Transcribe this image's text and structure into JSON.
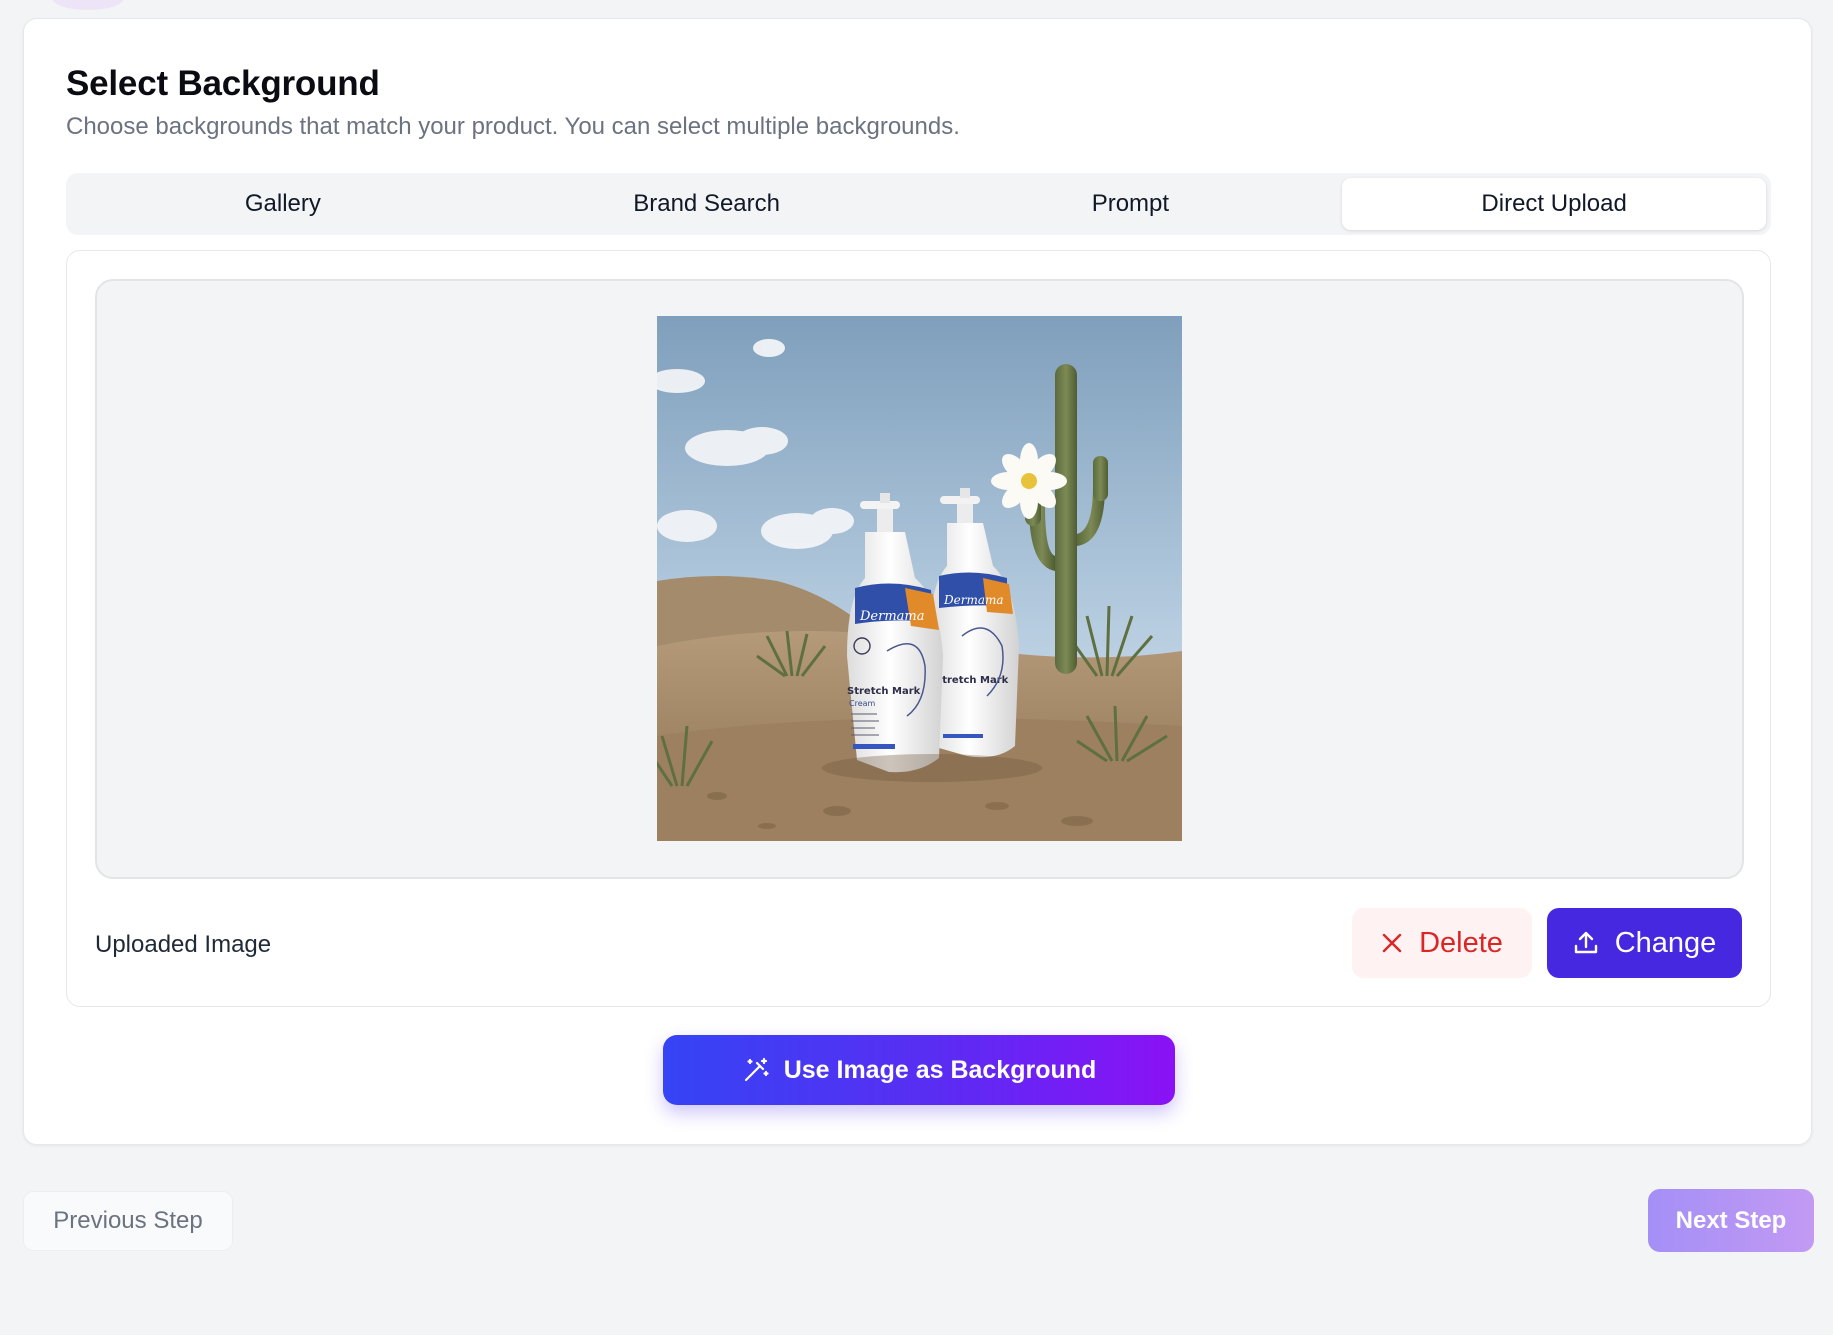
{
  "header": {
    "title": "Select Background",
    "subtitle": "Choose backgrounds that match your product. You can select multiple backgrounds."
  },
  "tabs": [
    {
      "label": "Gallery",
      "active": false
    },
    {
      "label": "Brand Search",
      "active": false
    },
    {
      "label": "Prompt",
      "active": false
    },
    {
      "label": "Direct Upload",
      "active": true
    }
  ],
  "upload": {
    "label": "Uploaded Image",
    "delete_label": "Delete",
    "change_label": "Change",
    "preview": {
      "brand_text": "Dermama",
      "product_text": "Stretch Mark",
      "product_subtext": "Cream",
      "scene": "Two white pump bottles on desert sand with a saguaro cactus, white flower, blue sky and clouds"
    }
  },
  "actions": {
    "use_background_label": "Use Image as Background",
    "previous_label": "Previous Step",
    "next_label": "Next Step"
  },
  "icons": {
    "delete": "x-icon",
    "change": "upload-icon",
    "use_background": "magic-wand-icon"
  },
  "colors": {
    "primary": "#4628e0",
    "danger": "#dc2626",
    "gradient_start": "#3544f4",
    "gradient_end": "#8b11f5"
  }
}
